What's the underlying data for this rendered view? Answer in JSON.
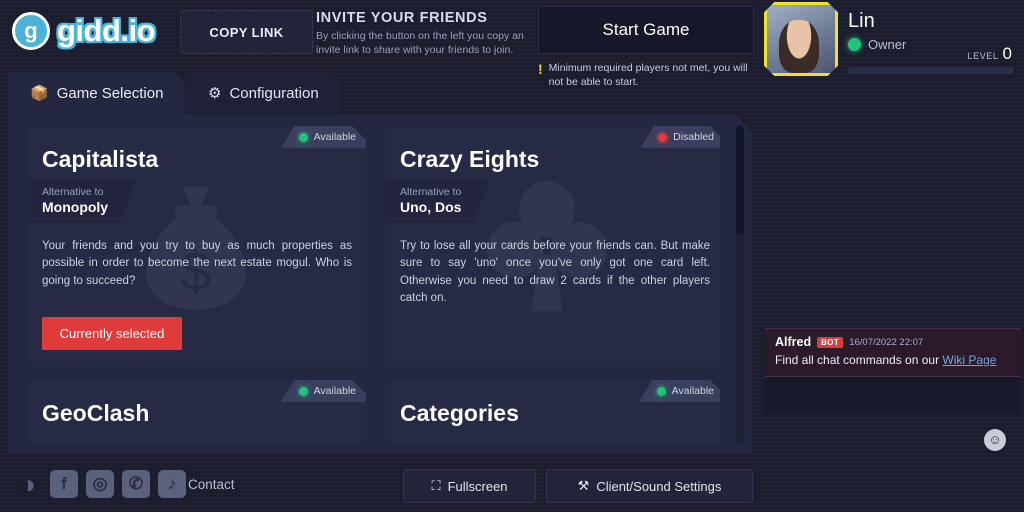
{
  "brand": {
    "name": "gidd.io",
    "logo_glyph": "g"
  },
  "topbar": {
    "copy_link_label": "COPY LINK",
    "invite_title": "INVITE YOUR FRIENDS",
    "invite_desc": "By clicking the button on the left you copy an invite link to share with your friends to join.",
    "start_game_label": "Start Game",
    "warning_icon": "!",
    "warning_text": "Minimum required players not met, you will not be able to start."
  },
  "player": {
    "name": "Lin",
    "role": "Owner",
    "level_label": "LEVEL",
    "level_value": "0",
    "status_color": "#23c17e",
    "avatar_border_color": "#f2e029"
  },
  "tabs": [
    {
      "label": "Game Selection",
      "icon": "cube-icon",
      "glyph": "📦",
      "active": true
    },
    {
      "label": "Configuration",
      "icon": "gear-icon",
      "glyph": "⚙",
      "active": false
    }
  ],
  "games": [
    {
      "title": "Capitalista",
      "status": "Available",
      "status_type": "ok",
      "alt_label": "Alternative to",
      "alt_value": "Monopoly",
      "description": "Your friends and you try to buy as much properties as possible in order to become the next estate mogul. Who is going to succeed?",
      "button_label": "Currently selected",
      "watermark": "money-bag-icon"
    },
    {
      "title": "Crazy Eights",
      "status": "Disabled",
      "status_type": "no",
      "alt_label": "Alternative to",
      "alt_value": "Uno, Dos",
      "description": "Try to lose all your cards before your friends can. But make sure to say 'uno' once you've only got one card left. Otherwise you need to draw 2 cards if the other players catch on.",
      "button_label": "",
      "watermark": "club-suit-icon"
    },
    {
      "title": "GeoClash",
      "status": "Available",
      "status_type": "ok"
    },
    {
      "title": "Categories",
      "status": "Available",
      "status_type": "ok"
    }
  ],
  "chat": {
    "message": {
      "user": "Alfred",
      "tag": "BOT",
      "time": "16/07/2022 22:07",
      "text_before": "Find all chat commands on our ",
      "link_text": "Wiki Page"
    },
    "emoji_glyph": "☺"
  },
  "footer": {
    "socials": [
      {
        "name": "discord-icon",
        "glyph": "◑"
      },
      {
        "name": "facebook-icon",
        "glyph": "f"
      },
      {
        "name": "instagram-icon",
        "glyph": "◎"
      },
      {
        "name": "twitter-icon",
        "glyph": "✆"
      },
      {
        "name": "tiktok-icon",
        "glyph": "♪"
      }
    ],
    "contact_label": "Contact",
    "fullscreen_label": "Fullscreen",
    "fullscreen_icon": "expand-icon",
    "settings_label": "Client/Sound Settings",
    "settings_icon": "tools-icon"
  },
  "accent": {
    "red": "#e03b3b",
    "green": "#23c17e",
    "yellow": "#f2e029",
    "blue": "#4ab3d8"
  }
}
